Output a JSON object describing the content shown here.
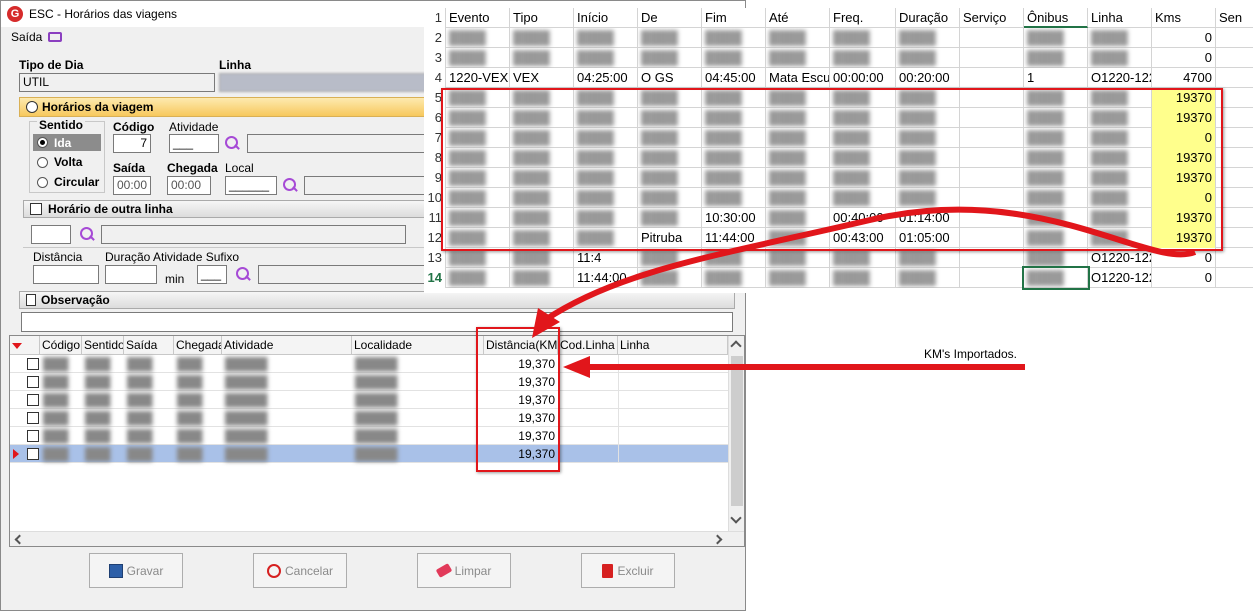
{
  "window": {
    "title": "ESC - Horários das viagens",
    "menu_saida": "Saída"
  },
  "form": {
    "tipo_dia_label": "Tipo de Dia",
    "tipo_dia_value": "UTIL",
    "linha_label": "Linha",
    "horarios_section": "Horários da viagem",
    "sentido_label": "Sentido",
    "ida": "Ida",
    "volta": "Volta",
    "circular": "Circular",
    "codigo_label": "Código",
    "codigo_value": "7",
    "atividade_label": "Atividade",
    "atividade_value": "___",
    "saida_label": "Saída",
    "saida_value": "00:00",
    "chegada_label": "Chegada",
    "chegada_value": "00:00",
    "local_label": "Local",
    "local_value": "______",
    "outra_linha_label": "Horário de outra linha",
    "distancia_label": "Distância",
    "duracao_label": "Duração Atividade Sufixo",
    "min_label": "min",
    "sufixo_value": "___",
    "observacao_label": "Observação"
  },
  "grid": {
    "columns": [
      "Código",
      "Sentido",
      "Saída",
      "Chegada",
      "Atividade",
      "Localidade",
      "Distância(KM)",
      "Cod.Linha",
      "Linha"
    ],
    "rows": [
      {
        "distancia": "19,370",
        "selected": false
      },
      {
        "distancia": "19,370",
        "selected": false
      },
      {
        "distancia": "19,370",
        "selected": false
      },
      {
        "distancia": "19,370",
        "selected": false
      },
      {
        "distancia": "19,370",
        "selected": false
      },
      {
        "distancia": "19,370",
        "selected": true
      }
    ]
  },
  "buttons": {
    "gravar": "Gravar",
    "cancelar": "Cancelar",
    "limpar": "Limpar",
    "excluir": "Excluir"
  },
  "spreadsheet": {
    "headers": [
      "Evento",
      "Tipo",
      "Início",
      "De",
      "Fim",
      "Até",
      "Freq.",
      "Duração",
      "Serviço",
      "Ônibus",
      "Linha",
      "Kms",
      "Sen"
    ],
    "rows": [
      {
        "n": "1",
        "kms": ""
      },
      {
        "n": "2",
        "kms": "0"
      },
      {
        "n": "3",
        "kms": "0"
      },
      {
        "n": "4",
        "kms": "4700",
        "evento": "1220-VEX",
        "tipo": "VEX",
        "inicio": "04:25:00",
        "de": "O GS",
        "fim": "04:45:00",
        "ate": "Mata Escu",
        "freq": "00:00:00",
        "dur": "00:20:00",
        "onibus": "1",
        "linha": "O1220-122"
      },
      {
        "n": "5",
        "kms": "19370",
        "yl": true
      },
      {
        "n": "6",
        "kms": "19370",
        "yl": true
      },
      {
        "n": "7",
        "kms": "0",
        "yl": true
      },
      {
        "n": "8",
        "kms": "19370",
        "yl": true
      },
      {
        "n": "9",
        "kms": "19370",
        "yl": true
      },
      {
        "n": "10",
        "kms": "0",
        "yl": true
      },
      {
        "n": "11",
        "kms": "19370",
        "yl": true,
        "fim": "10:30:00",
        "freq": "00:40:00",
        "dur": "01:14:00"
      },
      {
        "n": "12",
        "kms": "19370",
        "yl": true,
        "de": "Pitruba",
        "fim": "11:44:00",
        "freq": "00:43:00",
        "dur": "01:05:00"
      },
      {
        "n": "13",
        "kms": "0",
        "inicio": "11:4",
        "linha": "O1220-122"
      },
      {
        "n": "14",
        "kms": "0",
        "inicio": "11:44:00",
        "linha": "O1220-122"
      }
    ]
  },
  "callout": "KM's Importados.",
  "colors": {
    "accent_red": "#e1161b",
    "highlight_yellow": "#ffff8c",
    "selection_blue": "#a9c1e8"
  }
}
